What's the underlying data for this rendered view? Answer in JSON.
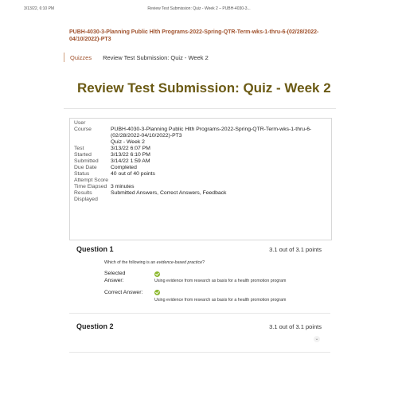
{
  "print_header": {
    "left": "3/13/22, 6:10 PM",
    "center": "Review Test Submission: Quiz - Week 2 – PUBH-4030-3..."
  },
  "course_title": "PUBH-4030-3-Planning Public Hlth Programs-2022-Spring-QTR-Term-wks-1-thru-6-(02/28/2022-04/10/2022)-PT3",
  "breadcrumb": {
    "link": "Quizzes",
    "current": "Review Test Submission: Quiz - Week 2"
  },
  "page_title": "Review Test Submission: Quiz - Week 2",
  "details": [
    {
      "label": "User",
      "value": ""
    },
    {
      "label": "Course",
      "value": "PUBH-4030-3-Planning Public Hlth Programs-2022-Spring-QTR-Term-wks-1-thru-6-(02/28/2022-04/10/2022)-PT3"
    },
    {
      "label": "",
      "value": "Quiz - Week 2"
    },
    {
      "label": "Test",
      "value": "3/13/22 6:07 PM"
    },
    {
      "label": "Started",
      "value": "3/13/22 6:10 PM"
    },
    {
      "label": "Submitted",
      "value": "3/14/22 1:59 AM"
    },
    {
      "label": "Due Date",
      "value": "Completed"
    },
    {
      "label": "Status",
      "value": "40 out of 40 points"
    },
    {
      "label": "Attempt Score",
      "value": ""
    },
    {
      "label": "Time Elapsed",
      "value": "3 minutes"
    },
    {
      "label": "Results Displayed",
      "value": "Submitted Answers, Correct Answers, Feedback"
    }
  ],
  "questions": [
    {
      "title": "Question 1",
      "score": "3.1 out of 3.1 points",
      "prompt_before": "Which of the following is an ",
      "prompt_em": "evidence-based practice",
      "prompt_after": "?",
      "selected_label": "Selected Answer:",
      "selected_answer": "Using evidence from research as basis for a health promotion program",
      "correct_label": "Correct Answer:",
      "correct_answer": "Using evidence from research as basis for a health promotion program"
    },
    {
      "title": "Question 2",
      "score": "3.1 out of 3.1 points"
    }
  ],
  "icons": {
    "correct": "check-circle-icon",
    "expand": "chevron-down-icon"
  },
  "colors": {
    "link": "#a0522d",
    "title": "#6b5a14",
    "check": "#8cb82d"
  }
}
